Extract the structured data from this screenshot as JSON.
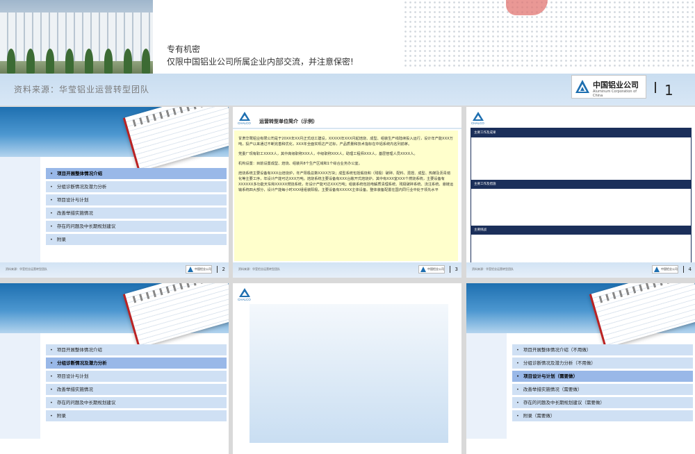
{
  "slide1": {
    "confidential_title": "专有机密",
    "confidential_note": "仅限中国铝业公司所属企业内部交流，并注意保密!",
    "source": "资料来源：华莹铝业运营转型团队",
    "logo_cn": "中国铝业公司",
    "logo_en": "Aluminum Corporation of China",
    "page_number": "1"
  },
  "footer": {
    "source_text": "资料来源：华莹铝业运营转型团队",
    "logo_text": "中国铝业公司"
  },
  "logo_abbr": "CHALCO",
  "slide2": {
    "page_number": "2",
    "menu": [
      "项目开展整体情况介绍",
      "分组诊断情况及潜力分析",
      "项目设计与计划",
      "改善举措实施情况",
      "存在的问题及中长期规划建议",
      "附录"
    ]
  },
  "slide3": {
    "page_number": "3",
    "title": "运营转型单位简介（示例）",
    "paragraphs": [
      "甘肃华鹭铝业有限公司是于20XX年XX月正式动工建设，XXXXX年XXX月起焙烧、成型、组装生产线陆续投入运行，设计年产能XXX万吨，投产以来通过不断完善和优化，XXX年全面实现达产达标，产品质量和技术指标在中铝系统内名列前茅。",
      "党委厂现有职工XXXX人，其中高级职称XXX人，中级职称XXX人，助理工程师XXX人，基层管理人员XXXX人。",
      "机构设置：目前设置成型、焙烧、组装共8个生产区域和1个综合业务办公室。",
      "焙烧系统主要设备有XXX台焙烧炉，年产阳极总数XXXX万块；成型系统包括煅烧和（残极）破碎、配料、混捏、成型、热媒及沥青熔化等主要工序，年设计产能可达XXX万吨。焙烧系统主要设备有XXX台敞开式焙烧炉，其中有XXX室XXX个燃烧系统，主要设备有XXXXXX多功能天车和XXXXX燃烧系统，年设计产能可达XXX万吨；组装系统包括电解质清理系统、残极破碎系统、浇注系统、悬链运输系统四大部分，设计产能每小时XXX组组装阳极，主要设备有XXXXX主体设备。整体装备配置在国内同行业中处于领先水平"
    ]
  },
  "slide4": {
    "page_number": "4",
    "bars": [
      "主要工作及成果",
      "主要工作及措施",
      "主要挑战"
    ]
  },
  "slide5": {
    "menu": [
      "项目开展整体情况介绍",
      "分组诊断情况及潜力分析",
      "项目设计与计划",
      "改善举措实施情况",
      "存在的问题及中长期规划建议",
      "附录"
    ]
  },
  "slide7": {
    "menu": [
      "项目开展整体情况介绍（不用做）",
      "分组诊断情况及潜力分析（不用做）",
      "项目设计与计划（需要做）",
      "改善举措实施情况（需要做）",
      "存在的问题及中长期规划建议（需要做）",
      "附录（需要做）"
    ]
  },
  "colors": {
    "header_blue": "#1e6fb0",
    "menu_item": "#cfe0f4",
    "menu_active": "#99b8e8",
    "navy_bar": "#1b2f5a",
    "note_yellow": "#ffffcc"
  }
}
